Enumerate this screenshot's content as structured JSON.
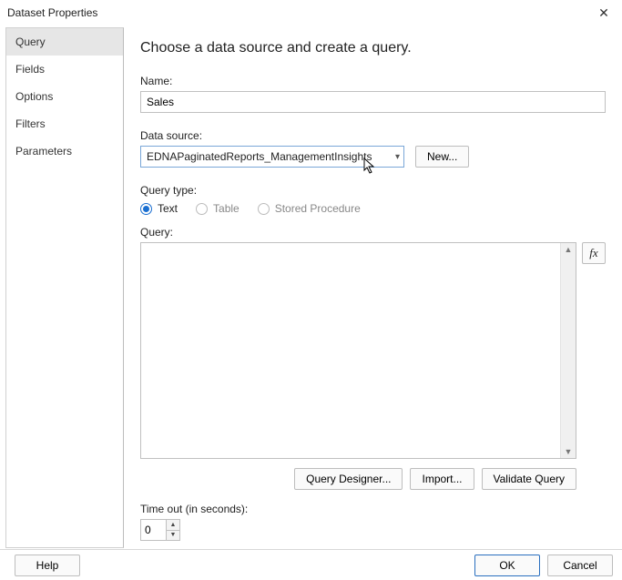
{
  "window": {
    "title": "Dataset Properties",
    "close_icon": "✕"
  },
  "sidebar": {
    "items": [
      {
        "label": "Query",
        "selected": true
      },
      {
        "label": "Fields",
        "selected": false
      },
      {
        "label": "Options",
        "selected": false
      },
      {
        "label": "Filters",
        "selected": false
      },
      {
        "label": "Parameters",
        "selected": false
      }
    ]
  },
  "main": {
    "heading": "Choose a data source and create a query.",
    "name_label": "Name:",
    "name_value": "Sales",
    "datasource_label": "Data source:",
    "datasource_value": "EDNAPaginatedReports_ManagementInsights",
    "new_button": "New...",
    "querytype_label": "Query type:",
    "querytype_options": [
      {
        "label": "Text",
        "selected": true,
        "disabled": false
      },
      {
        "label": "Table",
        "selected": false,
        "disabled": true
      },
      {
        "label": "Stored Procedure",
        "selected": false,
        "disabled": true
      }
    ],
    "query_label": "Query:",
    "query_value": "",
    "fx_label": "fx",
    "buttons": {
      "designer": "Query Designer...",
      "import": "Import...",
      "validate": "Validate Query"
    },
    "timeout_label": "Time out (in seconds):",
    "timeout_value": "0"
  },
  "footer": {
    "help": "Help",
    "ok": "OK",
    "cancel": "Cancel"
  }
}
